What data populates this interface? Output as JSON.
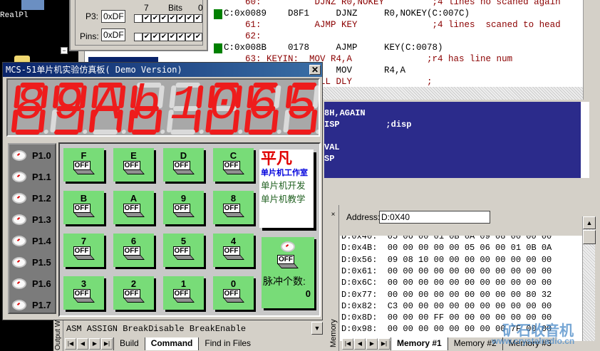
{
  "desktop": {
    "icon_label": "RealPl"
  },
  "port3": {
    "title": "Port 3",
    "bits_label": "Bits",
    "bit_hi": "7",
    "bit_lo": "0",
    "p3_label": "P3:",
    "p3_value": "0xDF",
    "pins_label": "Pins:",
    "pins_value": "0xDF",
    "p3_bits": [
      false,
      true,
      true,
      true,
      true,
      true,
      true,
      true
    ],
    "pins_bits": [
      false,
      true,
      true,
      true,
      true,
      true,
      true,
      true
    ],
    "check": "✔"
  },
  "tree": {
    "minus": "−"
  },
  "code": {
    "lines": [
      {
        "type": "src",
        "text": "    60:          DJNZ R0,NOKEY         ;4 lines no scaned again"
      },
      {
        "type": "asm",
        "text": "C:0x0089    D8F1     DJNZ     R0,NOKEY(C:007C)",
        "bp": true
      },
      {
        "type": "src",
        "text": "    61:          AJMP KEY              ;4 lines  scaned to head"
      },
      {
        "type": "src",
        "text": "    62:"
      },
      {
        "type": "asm",
        "text": "C:0x008B    0178     AJMP     KEY(C:0078)",
        "bp": true
      },
      {
        "type": "src",
        "text": "    63: KEYIN:  MOV R4,A              ;r4 has line num"
      },
      {
        "type": "asm",
        "text": "                     MOV      R4,A"
      },
      {
        "type": "src",
        "text": "                CALL DLY              ;"
      }
    ]
  },
  "editor": {
    "lines": [
      "8H,AGAIN",
      "ISP         ;disp",
      "",
      "VAL",
      "SP"
    ]
  },
  "simulator": {
    "title": "MCS-51单片机实验仿真板( Demo Version)",
    "close": "✕",
    "display": "89Ab1065",
    "p1_labels": [
      "P1.0",
      "P1.1",
      "P1.2",
      "P1.3",
      "P1.4",
      "P1.5",
      "P1.6",
      "P1.7"
    ],
    "keys": [
      "F",
      "E",
      "D",
      "C",
      "B",
      "A",
      "9",
      "8",
      "7",
      "6",
      "5",
      "4",
      "3",
      "2",
      "1",
      "0"
    ],
    "switch_label": "OFF",
    "logo": {
      "big": "平凡",
      "blue": "单片机工作室",
      "line1": "单片机开发",
      "line2": "单片机教学"
    },
    "pulse_label": "脉冲个数:",
    "pulse_value": "0",
    "seg_on": "#ee1c1c",
    "seg_off": "#dadada"
  },
  "output": {
    "side_label": "Output W",
    "command": "ASM ASSIGN BreakDisable BreakEnable",
    "tabs": [
      "Build",
      "Command",
      "Find in Files"
    ],
    "active_tab": "Command"
  },
  "memory": {
    "side_label": "Memory",
    "address_label": "Address:",
    "address_value": "D:0X40",
    "rows": [
      "D:0x40:  05 06 00 01 0B 0A 09 08 00 00 00",
      "D:0x4B:  00 00 00 00 00 05 06 00 01 0B 0A",
      "D:0x56:  09 08 10 00 00 00 00 00 00 00 00",
      "D:0x61:  00 00 00 00 00 00 00 00 00 00 00",
      "D:0x6C:  00 00 00 00 00 00 00 00 00 00 00",
      "D:0x77:  00 00 00 00 00 00 00 00 00 80 32",
      "D:0x82:  C3 00 00 00 00 00 00 00 00 00 00",
      "D:0x8D:  00 00 00 FF 00 00 00 00 00 00 00",
      "D:0x98:  00 00 00 00 00 00 00 00 7F 00 00"
    ],
    "tabs": [
      "Memory #1",
      "Memory #2",
      "Memory #3"
    ],
    "active_tab": "Memory #1"
  },
  "watermark": {
    "cn": "矿石收音机",
    "url": "www.crystalradio.cn"
  }
}
